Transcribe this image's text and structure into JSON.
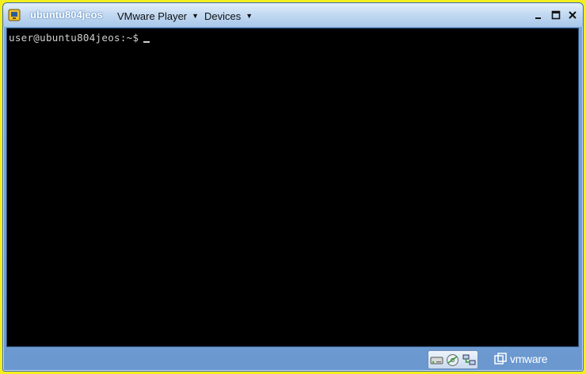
{
  "titlebar": {
    "vm_name": "ubuntu804jeos",
    "menu_player": "VMware Player",
    "menu_devices": "Devices"
  },
  "terminal": {
    "prompt": "user@ubuntu804jeos:~$"
  },
  "statusbar": {
    "brand": "vmware"
  },
  "colors": {
    "terminal_bg": "#000000",
    "terminal_fg": "#cfcfcf",
    "frame_blue": "#7aa6d8",
    "desktop_yellow": "#f2ee1f"
  },
  "icons": [
    "vmware-player-app-icon",
    "dropdown-arrow-icon",
    "minimize-icon",
    "maximize-icon",
    "close-icon",
    "hard-disk-icon",
    "cd-rom-icon",
    "network-adapter-icon",
    "vmware-logo-icon"
  ]
}
